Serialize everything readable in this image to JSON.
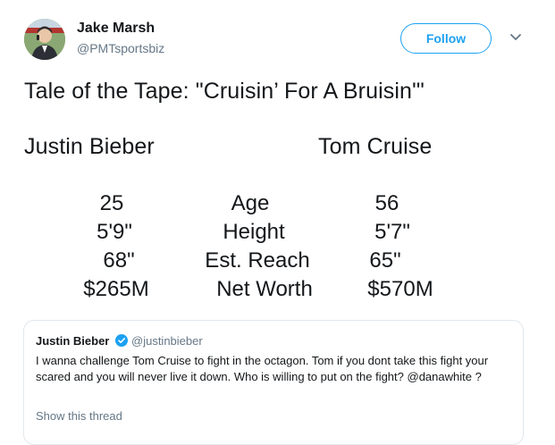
{
  "author": {
    "display_name": "Jake Marsh",
    "handle": "@PMTsportsbiz",
    "avatar_icon": "profile-photo"
  },
  "actions": {
    "follow_label": "Follow",
    "menu_icon": "chevron-down-icon"
  },
  "tweet": {
    "title": "Tale of the Tape: \"Cruisin’ For A Bruisin'\"",
    "fighter_left": "Justin Bieber",
    "fighter_right": "Tom Cruise",
    "rows": [
      {
        "left": "25",
        "label": "Age",
        "right": "56"
      },
      {
        "left": "5'9\"",
        "label": "Height",
        "right": "5'7\""
      },
      {
        "left": "68\"",
        "label": "Est. Reach",
        "right": "65\""
      },
      {
        "left": "$265M",
        "label": "Net Worth",
        "right": "$570M"
      }
    ]
  },
  "quoted_tweet": {
    "display_name": "Justin Bieber",
    "verified_icon": "verified-badge-icon",
    "handle": "@justinbieber",
    "text": "I wanna challenge Tom Cruise to fight in the octagon. Tom if you dont take this fight your scared and you will never live it down. Who is willing to put on the fight? @danawhite ?",
    "show_thread_label": "Show this thread"
  },
  "colors": {
    "accent": "#1da1f2",
    "secondary_text": "#657786",
    "border": "#e1e8ed"
  }
}
